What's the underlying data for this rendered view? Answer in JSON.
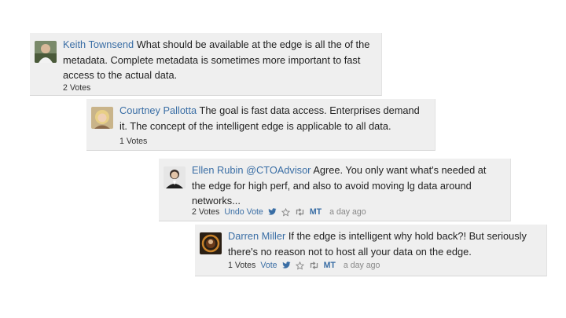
{
  "comments": [
    {
      "author": "Keith Townsend",
      "text": "What should be available at the edge is all the of the metadata. Complete metadata is sometimes more important to fast access to the actual data.",
      "votes": "2 Votes"
    },
    {
      "author": "Courtney Pallotta",
      "text": "The goal is fast data access. Enterprises demand it. The concept of the intelligent edge is applicable to all data.",
      "votes": "1 Votes"
    },
    {
      "author": "Ellen Rubin @CTOAdvisor",
      "text": "Agree. You only want what's needed at the edge for high perf, and also to avoid moving lg data around networks...",
      "votes": "2 Votes",
      "vote_action": "Undo Vote",
      "mt_label": "MT",
      "time": "a day ago",
      "icons": [
        "twitter-icon",
        "star-icon",
        "retweet-icon"
      ]
    },
    {
      "author": "Darren Miller",
      "text": "If the edge is intelligent why hold back?! But seriously there's no reason not to host all your data on the edge.",
      "votes": "1 Votes",
      "vote_action": "Vote",
      "mt_label": "MT",
      "time": "a day ago",
      "icons": [
        "twitter-icon",
        "star-icon",
        "retweet-icon"
      ]
    }
  ],
  "colors": {
    "link": "#3a6ea5",
    "card_bg": "#efefef",
    "muted": "#888888"
  }
}
